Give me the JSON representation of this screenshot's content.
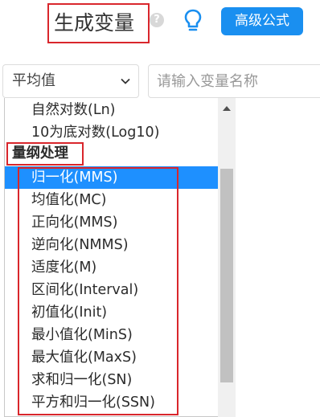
{
  "header": {
    "title": "生成变量",
    "help_icon": "question-circle-icon",
    "help_glyph": "?",
    "tip_icon": "lightbulb-icon",
    "advanced_label": "高级公式",
    "accent_color": "#1a8ff0"
  },
  "controls": {
    "select_value": "平均值",
    "input_placeholder": "请输入变量名称"
  },
  "dropdown": {
    "items_above": [
      "自然对数(Ln)",
      "10为底对数(Log10)"
    ],
    "group_label": "量纲处理",
    "items": [
      "归一化(MMS)",
      "均值化(MC)",
      "正向化(MMS)",
      "逆向化(NMMS)",
      "适度化(M)",
      "区间化(Interval)",
      "初值化(Init)",
      "最小值化(MinS)",
      "最大值化(MaxS)",
      "求和归一化(SN)",
      "平方和归一化(SSN)"
    ],
    "selected_item": "归一化(MMS)",
    "selected_color": "#1e90ff",
    "highlight_color": "#d9262c"
  }
}
